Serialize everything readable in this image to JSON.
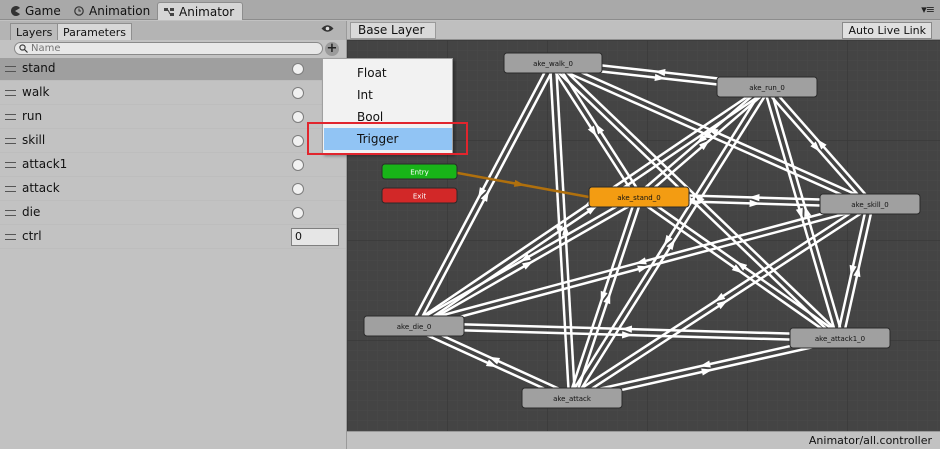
{
  "window_tabs": [
    {
      "label": "Game",
      "icon": "pacman-icon"
    },
    {
      "label": "Animation",
      "icon": "clock-icon"
    },
    {
      "label": "Animator",
      "icon": "animator-icon"
    }
  ],
  "left_panel": {
    "tabs": [
      "Layers",
      "Parameters"
    ],
    "search_placeholder": "Name",
    "parameters": [
      {
        "name": "stand",
        "type": "bool"
      },
      {
        "name": "walk",
        "type": "bool"
      },
      {
        "name": "run",
        "type": "bool"
      },
      {
        "name": "skill",
        "type": "bool"
      },
      {
        "name": "attack1",
        "type": "bool"
      },
      {
        "name": "attack",
        "type": "bool"
      },
      {
        "name": "die",
        "type": "bool"
      },
      {
        "name": "ctrl",
        "type": "int",
        "value": "0"
      }
    ]
  },
  "add_menu": {
    "items": [
      "Float",
      "Int",
      "Bool",
      "Trigger"
    ],
    "highlighted": "Trigger"
  },
  "graph": {
    "breadcrumb": "Base Layer",
    "auto_live_link": "Auto Live Link",
    "status_path": "Animator/all.controller",
    "states": {
      "walk": "ake_walk_0",
      "run": "ake_run_0",
      "entry": "Entry",
      "exit": "Exit",
      "stand": "ake_stand_0",
      "skill": "ake_skill_0",
      "die": "ake_die_0",
      "attack1": "ake_attack1_0",
      "attack": "ake_attack"
    }
  },
  "colors": {
    "default_state": "#a0a0a0",
    "default_state_highlight": "#f39c12",
    "entry": "#18b418",
    "exit": "#d22828",
    "highlight_menu": "#91c4f4",
    "annotation_box": "#e1252d",
    "graph_bg": "#444444"
  }
}
